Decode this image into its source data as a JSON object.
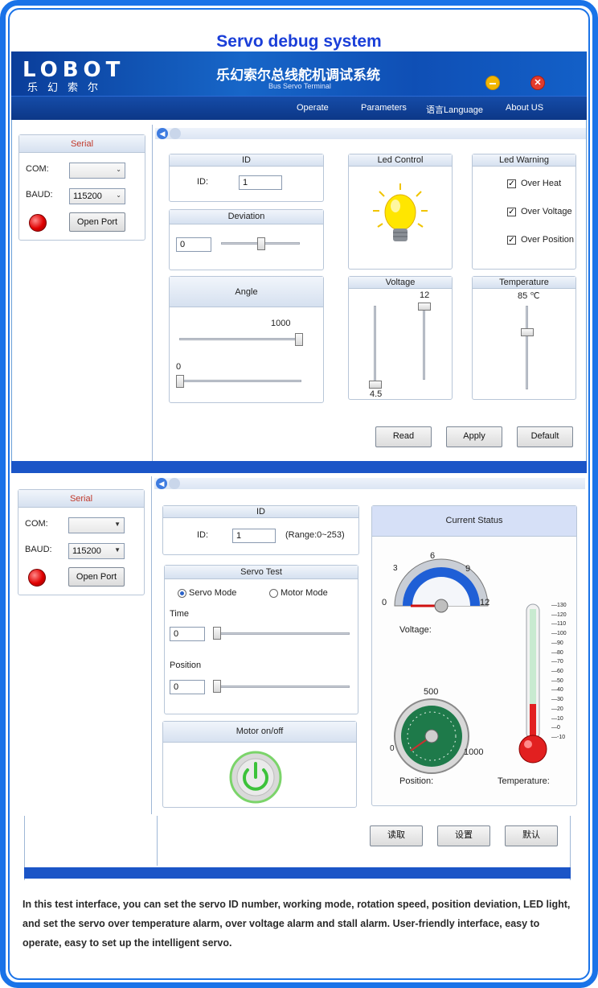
{
  "page": {
    "title": "Servo debug system"
  },
  "app": {
    "logo": "LOBOT",
    "logo_sub": "乐幻索尔",
    "title_cn": "乐幻索尔总线舵机调试系统",
    "title_en": "Bus Servo Terminal",
    "menu": [
      "Operate",
      "Parameters",
      "语言Language",
      "About US"
    ]
  },
  "serial": {
    "title": "Serial",
    "com_label": "COM:",
    "com_value": "",
    "baud_label": "BAUD:",
    "baud_value": "115200",
    "open_port": "Open Port"
  },
  "top": {
    "id_group": {
      "title": "ID",
      "label": "ID:",
      "value": "1"
    },
    "deviation": {
      "title": "Deviation",
      "value": "0",
      "slider": 0.5
    },
    "angle": {
      "title": "Angle",
      "max_label": "1000",
      "min_label": "0",
      "max_slider": 1.0,
      "min_slider": 0.0
    },
    "led_control": {
      "title": "Led Control"
    },
    "led_warning": {
      "title": "Led Warning",
      "items": [
        {
          "label": "Over Heat",
          "checked": true
        },
        {
          "label": "Over Voltage",
          "checked": true
        },
        {
          "label": "Over Position",
          "checked": true
        }
      ]
    },
    "voltage": {
      "title": "Voltage",
      "max_label": "12",
      "min_label": "4.5"
    },
    "temperature": {
      "title": "Temperature",
      "value_label": "85 ℃"
    },
    "buttons": {
      "read": "Read",
      "apply": "Apply",
      "default": "Default"
    }
  },
  "bottom": {
    "id_group": {
      "title": "ID",
      "label": "ID:",
      "value": "1",
      "range": "(Range:0~253)"
    },
    "servo_test": {
      "title": "Servo Test",
      "servo_mode": "Servo Mode",
      "motor_mode": "Motor Mode",
      "time_label": "Time",
      "time_value": "0",
      "position_label": "Position",
      "position_value": "0"
    },
    "motor": {
      "title": "Motor on/off"
    },
    "status": {
      "title": "Current Status",
      "voltage_ticks": [
        "0",
        "3",
        "6",
        "9",
        "12"
      ],
      "voltage_label": "Voltage:",
      "position_ticks": [
        "0",
        "500",
        "1000"
      ],
      "position_label": "Position:",
      "temperature_label": "Temperature:",
      "thermo_ticks": [
        "130",
        "120",
        "110",
        "100",
        "90",
        "80",
        "70",
        "60",
        "50",
        "40",
        "30",
        "20",
        "10",
        "0",
        "-10"
      ]
    },
    "buttons": {
      "read": "读取",
      "apply": "设置",
      "default": "默认"
    }
  },
  "description": "In this test interface, you can set the servo ID number, working mode, rotation speed, position deviation, LED light, and set the servo over temperature alarm, over voltage alarm and stall alarm. User-friendly interface, easy to operate, easy to set up the intelligent servo.",
  "colors": {
    "accent": "#1a73e8",
    "title": "#1a3ed8",
    "banner": "#0f4fb5",
    "status_bg": "#d6e0f7"
  }
}
